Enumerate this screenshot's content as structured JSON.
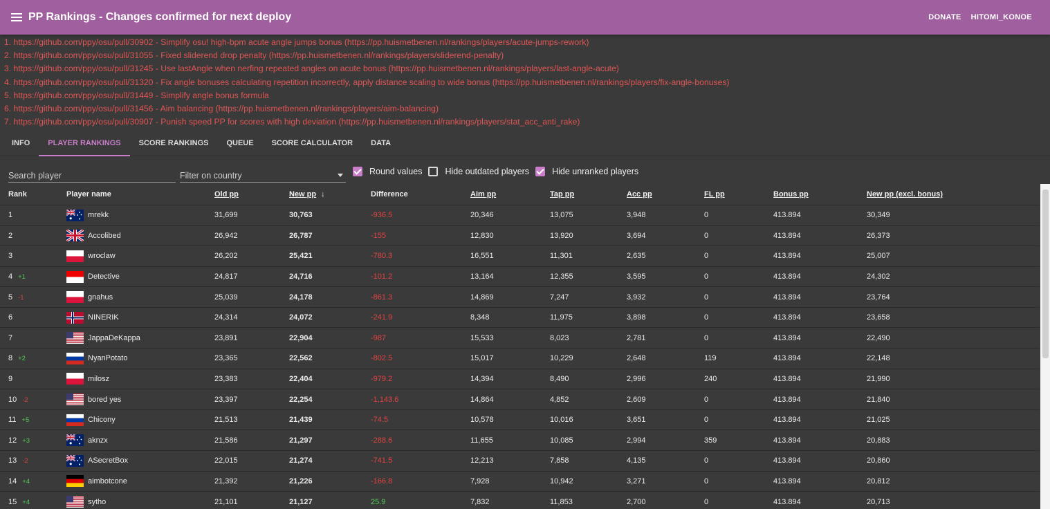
{
  "app": {
    "title": "PP Rankings - Changes confirmed for next deploy",
    "actions": [
      "DONATE",
      "HITOMI_KONOE"
    ]
  },
  "changes": [
    "1. https://github.com/ppy/osu/pull/30902 - Simplify osu! high-bpm acute angle jumps bonus (https://pp.huismetbenen.nl/rankings/players/acute-jumps-rework)",
    "2. https://github.com/ppy/osu/pull/31055 - Fixed sliderend drop penalty (https://pp.huismetbenen.nl/rankings/players/sliderend-penalty)",
    "3. https://github.com/ppy/osu/pull/31245 - Use lastAngle when nerfing repeated angles on acute bonus (https://pp.huismetbenen.nl/rankings/players/last-angle-acute)",
    "4. https://github.com/ppy/osu/pull/31320 - Fix angle bonuses calculating repetition incorrectly, apply distance scaling to wide bonus (https://pp.huismetbenen.nl/rankings/players/fix-angle-bonuses)",
    "5. https://github.com/ppy/osu/pull/31449 - Simplify angle bonus formula",
    "6. https://github.com/ppy/osu/pull/31456 - Aim balancing (https://pp.huismetbenen.nl/rankings/players/aim-balancing)",
    "7. https://github.com/ppy/osu/pull/30907 - Punish speed PP for scores with high deviation (https://pp.huismetbenen.nl/rankings/players/stat_acc_anti_rake)"
  ],
  "tabs": [
    "INFO",
    "PLAYER RANKINGS",
    "SCORE RANKINGS",
    "QUEUE",
    "SCORE CALCULATOR",
    "DATA"
  ],
  "active_tab": "PLAYER RANKINGS",
  "filters": {
    "search_placeholder": "Search player",
    "country_placeholder": "Filter on country",
    "round_values": "Round values",
    "hide_outdated": "Hide outdated players",
    "hide_unranked": "Hide unranked players"
  },
  "columns": [
    "Rank",
    "Player name",
    "Old pp",
    "New pp",
    "Difference",
    "Aim pp",
    "Tap pp",
    "Acc pp",
    "FL pp",
    "Bonus pp",
    "New pp (excl. bonus)"
  ],
  "rows": [
    {
      "rank": "1",
      "change": "",
      "flag": "au",
      "name": "mrekk",
      "old": "31,699",
      "new": "30,763",
      "diff": "-936.5",
      "aim": "20,346",
      "tap": "13,075",
      "acc": "3,948",
      "fl": "0",
      "bonus": "413.894",
      "excl": "30,349"
    },
    {
      "rank": "2",
      "change": "",
      "flag": "gb",
      "name": "Accolibed",
      "old": "26,942",
      "new": "26,787",
      "diff": "-155",
      "aim": "12,830",
      "tap": "13,920",
      "acc": "3,694",
      "fl": "0",
      "bonus": "413.894",
      "excl": "26,373"
    },
    {
      "rank": "3",
      "change": "",
      "flag": "pl",
      "name": "wroclaw",
      "old": "26,202",
      "new": "25,421",
      "diff": "-780.3",
      "aim": "16,551",
      "tap": "11,301",
      "acc": "2,635",
      "fl": "0",
      "bonus": "413.894",
      "excl": "25,007"
    },
    {
      "rank": "4",
      "change": "+1",
      "flag": "id",
      "name": "Detective",
      "old": "24,817",
      "new": "24,716",
      "diff": "-101.2",
      "aim": "13,164",
      "tap": "12,355",
      "acc": "3,595",
      "fl": "0",
      "bonus": "413.894",
      "excl": "24,302"
    },
    {
      "rank": "5",
      "change": "-1",
      "flag": "pl",
      "name": "gnahus",
      "old": "25,039",
      "new": "24,178",
      "diff": "-861.3",
      "aim": "14,869",
      "tap": "7,247",
      "acc": "3,932",
      "fl": "0",
      "bonus": "413.894",
      "excl": "23,764"
    },
    {
      "rank": "6",
      "change": "",
      "flag": "no",
      "name": "NINERIK",
      "old": "24,314",
      "new": "24,072",
      "diff": "-241.9",
      "aim": "8,348",
      "tap": "11,975",
      "acc": "3,898",
      "fl": "0",
      "bonus": "413.894",
      "excl": "23,658"
    },
    {
      "rank": "7",
      "change": "",
      "flag": "us",
      "name": "JappaDeKappa",
      "old": "23,891",
      "new": "22,904",
      "diff": "-987",
      "aim": "15,533",
      "tap": "8,023",
      "acc": "2,781",
      "fl": "0",
      "bonus": "413.894",
      "excl": "22,490"
    },
    {
      "rank": "8",
      "change": "+2",
      "flag": "ru",
      "name": "NyanPotato",
      "old": "23,365",
      "new": "22,562",
      "diff": "-802.5",
      "aim": "15,017",
      "tap": "10,229",
      "acc": "2,648",
      "fl": "119",
      "bonus": "413.894",
      "excl": "22,148"
    },
    {
      "rank": "9",
      "change": "",
      "flag": "pl",
      "name": "milosz",
      "old": "23,383",
      "new": "22,404",
      "diff": "-979.2",
      "aim": "14,394",
      "tap": "8,490",
      "acc": "2,996",
      "fl": "240",
      "bonus": "413.894",
      "excl": "21,990"
    },
    {
      "rank": "10",
      "change": "-2",
      "flag": "us",
      "name": "bored yes",
      "old": "23,397",
      "new": "22,254",
      "diff": "-1,143.6",
      "aim": "14,864",
      "tap": "4,852",
      "acc": "2,609",
      "fl": "0",
      "bonus": "413.894",
      "excl": "21,840"
    },
    {
      "rank": "11",
      "change": "+5",
      "flag": "ru",
      "name": "Chicony",
      "old": "21,513",
      "new": "21,439",
      "diff": "-74.5",
      "aim": "10,578",
      "tap": "10,016",
      "acc": "3,651",
      "fl": "0",
      "bonus": "413.894",
      "excl": "21,025"
    },
    {
      "rank": "12",
      "change": "+3",
      "flag": "au",
      "name": "aknzx",
      "old": "21,586",
      "new": "21,297",
      "diff": "-288.6",
      "aim": "11,655",
      "tap": "10,085",
      "acc": "2,994",
      "fl": "359",
      "bonus": "413.894",
      "excl": "20,883"
    },
    {
      "rank": "13",
      "change": "-2",
      "flag": "au",
      "name": "ASecretBox",
      "old": "22,015",
      "new": "21,274",
      "diff": "-741.5",
      "aim": "12,213",
      "tap": "7,858",
      "acc": "4,135",
      "fl": "0",
      "bonus": "413.894",
      "excl": "20,860"
    },
    {
      "rank": "14",
      "change": "+4",
      "flag": "de",
      "name": "aimbotcone",
      "old": "21,392",
      "new": "21,226",
      "diff": "-166.8",
      "aim": "7,928",
      "tap": "10,942",
      "acc": "3,271",
      "fl": "0",
      "bonus": "413.894",
      "excl": "20,812"
    },
    {
      "rank": "15",
      "change": "+4",
      "flag": "us",
      "name": "sytho",
      "old": "21,101",
      "new": "21,127",
      "diff": "25.9",
      "aim": "7,832",
      "tap": "11,853",
      "acc": "2,700",
      "fl": "0",
      "bonus": "413.894",
      "excl": "20,713"
    }
  ],
  "colors": {
    "appbar": "#a060a0",
    "accent": "#c97ec9",
    "negative": "#e04444",
    "positive": "#55cc55"
  }
}
